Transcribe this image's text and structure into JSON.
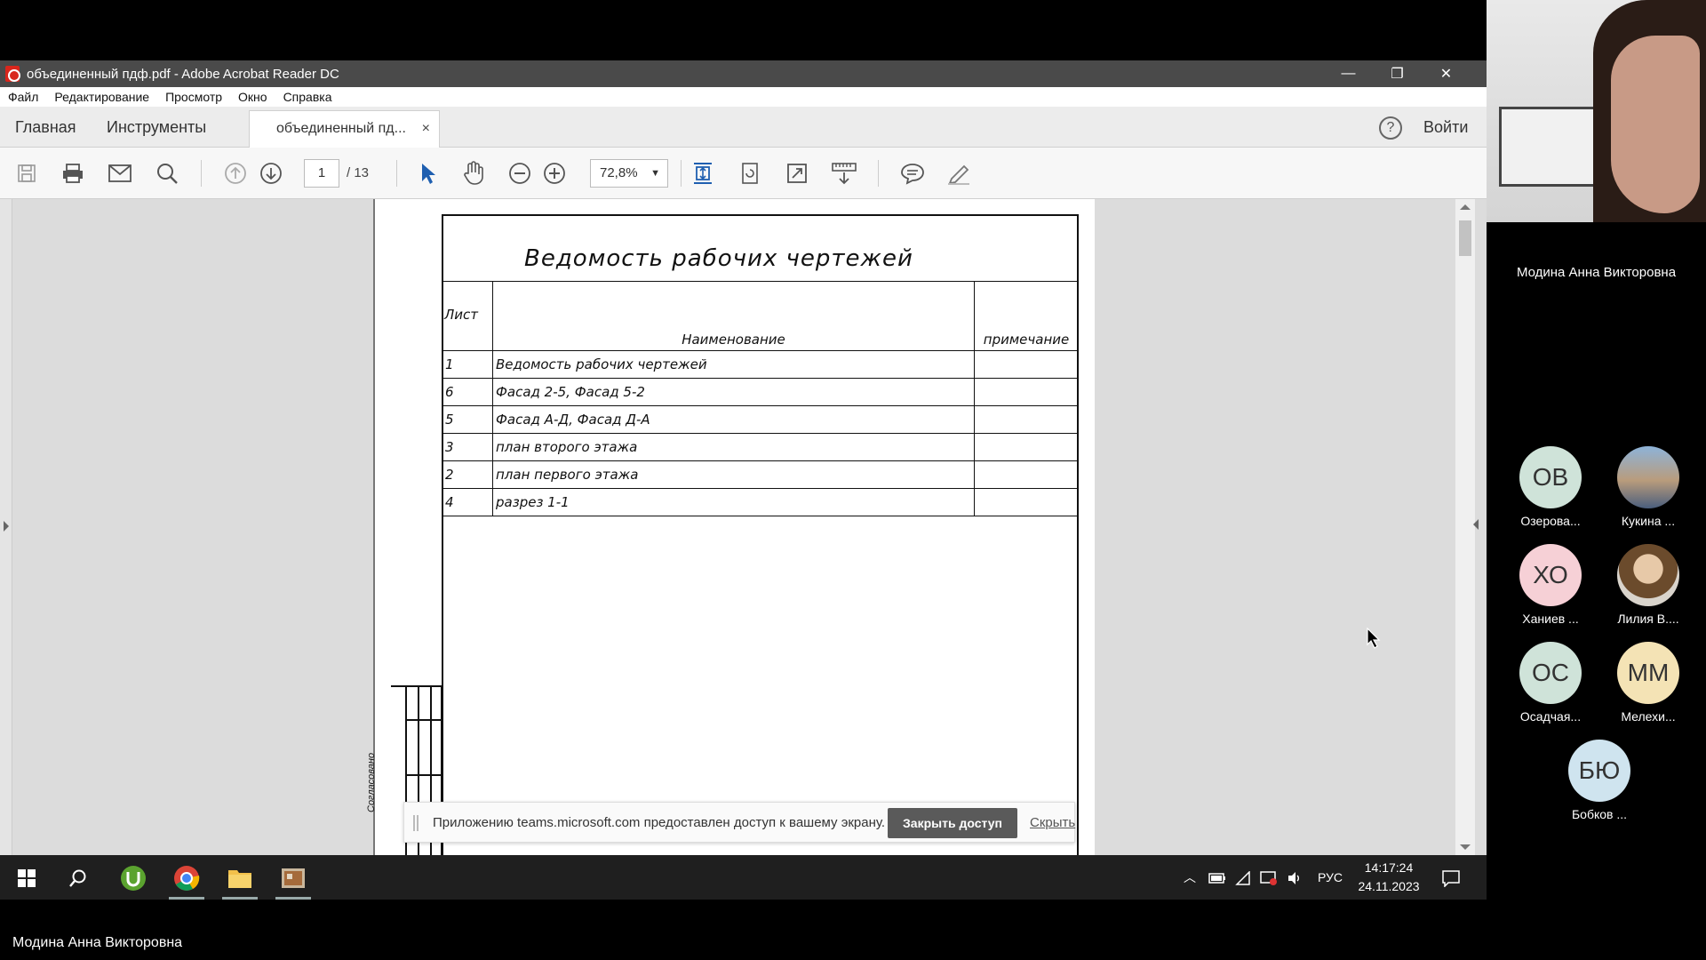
{
  "window": {
    "title": "объединенный пдф.pdf - Adobe Acrobat Reader DC",
    "controls": [
      "—",
      "❐",
      "✕"
    ]
  },
  "menu": [
    "Файл",
    "Редактирование",
    "Просмотр",
    "Окно",
    "Справка"
  ],
  "tabs": {
    "home": "Главная",
    "tools": "Инструменты",
    "document": "объединенный пд...",
    "close": "×",
    "help": "?",
    "login": "Войти"
  },
  "toolbar": {
    "page_current": "1",
    "page_total": "/ 13",
    "zoom": "72,8%",
    "zoom_caret": "▼",
    "icons": [
      "save-icon",
      "print-icon",
      "email-icon",
      "search-icon",
      "page-up-icon",
      "page-down-icon",
      "select-icon",
      "hand-icon",
      "zoom-out-icon",
      "zoom-in-icon",
      "fit-page-icon",
      "rotate-icon",
      "fullscreen-icon",
      "scroll-mode-icon",
      "comment-icon",
      "highlight-icon"
    ]
  },
  "document": {
    "title": "Ведомость рабочих чертежей",
    "headers": {
      "sheet": "Лист",
      "name": "Наименование",
      "note": "примечание"
    },
    "rows": [
      {
        "sheet": "1",
        "name": "Ведомость рабочих чертежей",
        "note": ""
      },
      {
        "sheet": "6",
        "name": "Фасад 2-5, Фасад 5-2",
        "note": ""
      },
      {
        "sheet": "5",
        "name": "Фасад А-Д, Фасад Д-А",
        "note": ""
      },
      {
        "sheet": "3",
        "name": "план второго этажа",
        "note": ""
      },
      {
        "sheet": "2",
        "name": "план первого этажа",
        "note": ""
      },
      {
        "sheet": "4",
        "name": "разрез 1-1",
        "note": ""
      }
    ],
    "stamp_label": "Согласовано"
  },
  "share_banner": {
    "message": "Приложению teams.microsoft.com предоставлен доступ к вашему экрану.",
    "stop": "Закрыть доступ",
    "hide": "Скрыть"
  },
  "taskbar": {
    "lang": "РУС",
    "time": "14:17:24",
    "date": "24.11.2023"
  },
  "presenter": "Модина Анна Викторовна",
  "participants": [
    {
      "initials": "ОВ",
      "name": "Озерова...",
      "color": "#cfe3d9"
    },
    {
      "initials": "",
      "name": "Кукина ...",
      "color": "#8db3d9"
    },
    {
      "initials": "ХО",
      "name": "Ханиев ...",
      "color": "#f6d0d6"
    },
    {
      "initials": "",
      "name": "Лилия В....",
      "color": "#d9d4cc"
    },
    {
      "initials": "ОС",
      "name": "Осадчая...",
      "color": "#cfe3d9"
    },
    {
      "initials": "ММ",
      "name": "Мелехи...",
      "color": "#f4e3b5"
    },
    {
      "initials": "БЮ",
      "name": "Бобков ...",
      "color": "#cfe4ef"
    }
  ]
}
